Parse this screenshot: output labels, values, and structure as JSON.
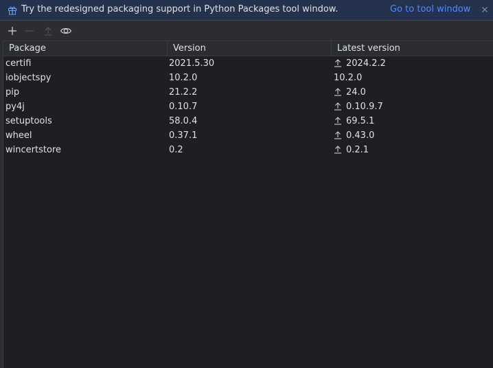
{
  "banner": {
    "icon": "gift-icon",
    "text": "Try the redesigned packaging support in Python Packages tool window.",
    "link": "Go to tool window",
    "close_icon": "close-icon"
  },
  "toolbar": {
    "buttons": [
      {
        "name": "add-package-button",
        "icon": "plus-icon",
        "enabled": true
      },
      {
        "name": "remove-package-button",
        "icon": "minus-icon",
        "enabled": false
      },
      {
        "name": "upgrade-package-button",
        "icon": "arrow-up-icon",
        "enabled": false
      },
      {
        "name": "show-early-releases-button",
        "icon": "eye-icon",
        "enabled": true
      }
    ]
  },
  "table": {
    "headers": [
      "Package",
      "Version",
      "Latest version"
    ],
    "rows": [
      {
        "package": "certifi",
        "version": "2021.5.30",
        "latest": "2024.2.2",
        "upgrade": true
      },
      {
        "package": "iobjectspy",
        "version": "10.2.0",
        "latest": "10.2.0",
        "upgrade": false
      },
      {
        "package": "pip",
        "version": "21.2.2",
        "latest": "24.0",
        "upgrade": true
      },
      {
        "package": "py4j",
        "version": "0.10.7",
        "latest": "0.10.9.7",
        "upgrade": true
      },
      {
        "package": "setuptools",
        "version": "58.0.4",
        "latest": "69.5.1",
        "upgrade": true
      },
      {
        "package": "wheel",
        "version": "0.37.1",
        "latest": "0.43.0",
        "upgrade": true
      },
      {
        "package": "wincertstore",
        "version": "0.2",
        "latest": "0.2.1",
        "upgrade": true
      }
    ]
  },
  "colors": {
    "banner_bg": "#25324d",
    "link": "#548af7",
    "table_bg": "#1e1f22",
    "panel_bg": "#2b2d30",
    "text": "#dfe1e5"
  }
}
